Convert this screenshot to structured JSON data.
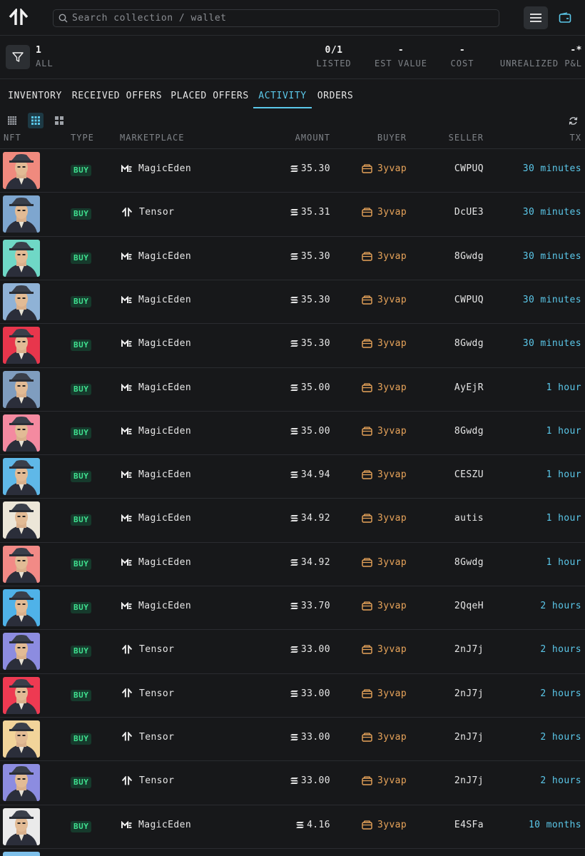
{
  "header": {
    "logo": "tensor-logo-icon",
    "search_placeholder": "Search collection / wallet"
  },
  "summary": {
    "count": "1",
    "count_label": "ALL",
    "listed": "0/1",
    "listed_label": "LISTED",
    "est_value": "-",
    "est_value_label": "EST VALUE",
    "cost": "-",
    "cost_label": "COST",
    "pnl": "-*",
    "pnl_label": "UNREALIZED P&L"
  },
  "tabs": [
    {
      "label": "INVENTORY",
      "active": false
    },
    {
      "label": "RECEIVED OFFERS",
      "active": false
    },
    {
      "label": "PLACED OFFERS",
      "active": false
    },
    {
      "label": "ACTIVITY",
      "active": true
    },
    {
      "label": "ORDERS",
      "active": false
    }
  ],
  "columns": {
    "nft": "NFT",
    "type": "TYPE",
    "marketplace": "MARKETPLACE",
    "amount": "AMOUNT",
    "buyer": "BUYER",
    "seller": "SELLER",
    "tx": "TX"
  },
  "colors": {
    "accent": "#5bc8ea",
    "buy_badge_bg": "#163a2c",
    "buy_badge_text": "#3fe08f",
    "buyer": "#e8a45a",
    "background": "#17181a"
  },
  "rows": [
    {
      "type": "BUY",
      "marketplace": "MagicEden",
      "amount": "35.30",
      "buyer": "3yvap",
      "seller": "CWPUQ",
      "tx": "30 minutes",
      "bg": "#f08a7e"
    },
    {
      "type": "BUY",
      "marketplace": "Tensor",
      "amount": "35.31",
      "buyer": "3yvap",
      "seller": "DcUE3",
      "tx": "30 minutes",
      "bg": "#7ea6cf"
    },
    {
      "type": "BUY",
      "marketplace": "MagicEden",
      "amount": "35.30",
      "buyer": "3yvap",
      "seller": "8Gwdg",
      "tx": "30 minutes",
      "bg": "#6fd8c6"
    },
    {
      "type": "BUY",
      "marketplace": "MagicEden",
      "amount": "35.30",
      "buyer": "3yvap",
      "seller": "CWPUQ",
      "tx": "30 minutes",
      "bg": "#8fb2d6"
    },
    {
      "type": "BUY",
      "marketplace": "MagicEden",
      "amount": "35.30",
      "buyer": "3yvap",
      "seller": "8Gwdg",
      "tx": "30 minutes",
      "bg": "#e8364c"
    },
    {
      "type": "BUY",
      "marketplace": "MagicEden",
      "amount": "35.00",
      "buyer": "3yvap",
      "seller": "AyEjR",
      "tx": "1 hour",
      "bg": "#7f9dbf"
    },
    {
      "type": "BUY",
      "marketplace": "MagicEden",
      "amount": "35.00",
      "buyer": "3yvap",
      "seller": "8Gwdg",
      "tx": "1 hour",
      "bg": "#f48aa0"
    },
    {
      "type": "BUY",
      "marketplace": "MagicEden",
      "amount": "34.94",
      "buyer": "3yvap",
      "seller": "CESZU",
      "tx": "1 hour",
      "bg": "#5fb8e8"
    },
    {
      "type": "BUY",
      "marketplace": "MagicEden",
      "amount": "34.92",
      "buyer": "3yvap",
      "seller": "autis",
      "tx": "1 hour",
      "bg": "#ece6d8"
    },
    {
      "type": "BUY",
      "marketplace": "MagicEden",
      "amount": "34.92",
      "buyer": "3yvap",
      "seller": "8Gwdg",
      "tx": "1 hour",
      "bg": "#f28a86"
    },
    {
      "type": "BUY",
      "marketplace": "MagicEden",
      "amount": "33.70",
      "buyer": "3yvap",
      "seller": "2QqeH",
      "tx": "2 hours",
      "bg": "#4fb2e8"
    },
    {
      "type": "BUY",
      "marketplace": "Tensor",
      "amount": "33.00",
      "buyer": "3yvap",
      "seller": "2nJ7j",
      "tx": "2 hours",
      "bg": "#8c8ce0"
    },
    {
      "type": "BUY",
      "marketplace": "Tensor",
      "amount": "33.00",
      "buyer": "3yvap",
      "seller": "2nJ7j",
      "tx": "2 hours",
      "bg": "#ee3a52"
    },
    {
      "type": "BUY",
      "marketplace": "Tensor",
      "amount": "33.00",
      "buyer": "3yvap",
      "seller": "2nJ7j",
      "tx": "2 hours",
      "bg": "#f2d49a"
    },
    {
      "type": "BUY",
      "marketplace": "Tensor",
      "amount": "33.00",
      "buyer": "3yvap",
      "seller": "2nJ7j",
      "tx": "2 hours",
      "bg": "#8c8ce0"
    },
    {
      "type": "BUY",
      "marketplace": "MagicEden",
      "amount": "4.16",
      "buyer": "3yvap",
      "seller": "E4SFa",
      "tx": "10 months",
      "bg": "#eaeaea"
    }
  ]
}
